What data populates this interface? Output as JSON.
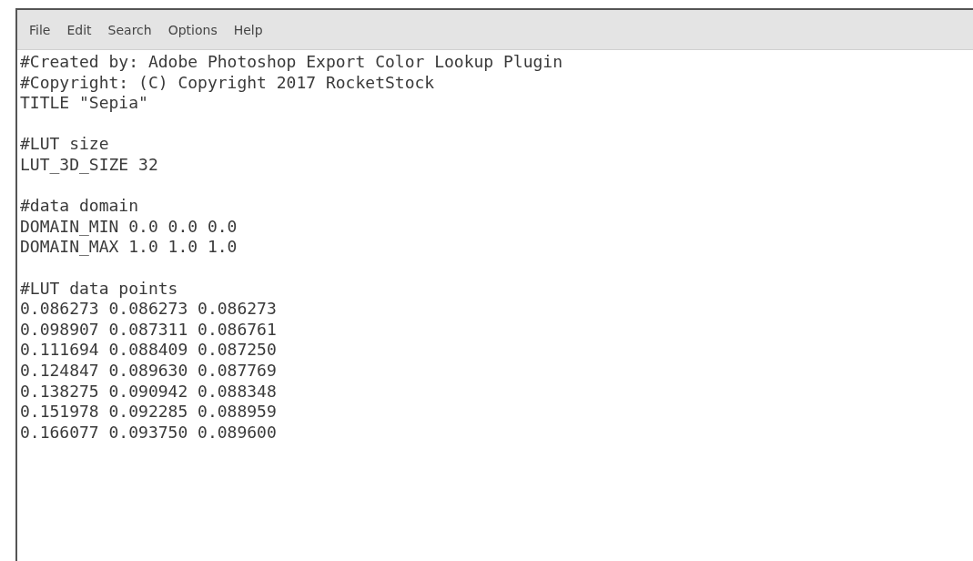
{
  "menu": [
    "File",
    "Edit",
    "Search",
    "Options",
    "Help"
  ],
  "editor": {
    "blocks": [
      [
        "#Created by: Adobe Photoshop Export Color Lookup Plugin",
        "#Copyright: (C) Copyright 2017 RocketStock",
        "TITLE \"Sepia\""
      ],
      [
        "#LUT size",
        "LUT_3D_SIZE 32"
      ],
      [
        "#data domain",
        "DOMAIN_MIN 0.0 0.0 0.0",
        "DOMAIN_MAX 1.0 1.0 1.0"
      ],
      [
        "#LUT data points",
        "0.086273 0.086273 0.086273",
        "0.098907 0.087311 0.086761",
        "0.111694 0.088409 0.087250",
        "0.124847 0.089630 0.087769",
        "0.138275 0.090942 0.088348",
        "0.151978 0.092285 0.088959",
        "0.166077 0.093750 0.089600"
      ]
    ]
  }
}
